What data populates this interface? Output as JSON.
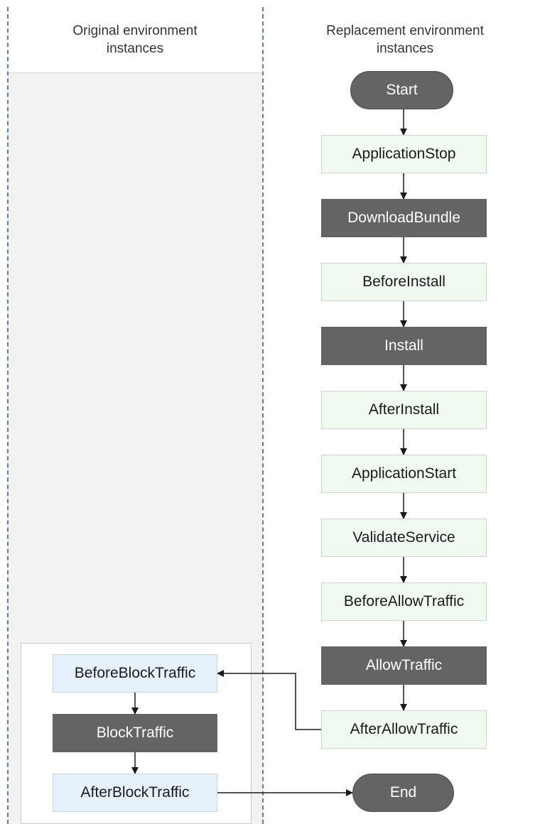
{
  "lanes": {
    "original": {
      "title_line1": "Original environment",
      "title_line2": "instances"
    },
    "replacement": {
      "title_line1": "Replacement environment",
      "title_line2": "instances"
    }
  },
  "nodes": {
    "start": "Start",
    "application_stop": "ApplicationStop",
    "download_bundle": "DownloadBundle",
    "before_install": "BeforeInstall",
    "install": "Install",
    "after_install": "AfterInstall",
    "application_start": "ApplicationStart",
    "validate_service": "ValidateService",
    "before_allow_traffic": "BeforeAllowTraffic",
    "allow_traffic": "AllowTraffic",
    "after_allow_traffic": "AfterAllowTraffic",
    "before_block_traffic": "BeforeBlockTraffic",
    "block_traffic": "BlockTraffic",
    "after_block_traffic": "AfterBlockTraffic",
    "end": "End"
  },
  "colors": {
    "hook_node": "#f1faf1",
    "managed_node": "#646464",
    "original_hook_node": "#e6f1fb",
    "lane_divider": "#5b7fa6",
    "arrow": "#1a1a1a"
  },
  "edges": [
    [
      "start",
      "application_stop"
    ],
    [
      "application_stop",
      "download_bundle"
    ],
    [
      "download_bundle",
      "before_install"
    ],
    [
      "before_install",
      "install"
    ],
    [
      "install",
      "after_install"
    ],
    [
      "after_install",
      "application_start"
    ],
    [
      "application_start",
      "validate_service"
    ],
    [
      "validate_service",
      "before_allow_traffic"
    ],
    [
      "before_allow_traffic",
      "allow_traffic"
    ],
    [
      "allow_traffic",
      "after_allow_traffic"
    ],
    [
      "after_allow_traffic",
      "before_block_traffic"
    ],
    [
      "before_block_traffic",
      "block_traffic"
    ],
    [
      "block_traffic",
      "after_block_traffic"
    ],
    [
      "after_block_traffic",
      "end"
    ]
  ]
}
